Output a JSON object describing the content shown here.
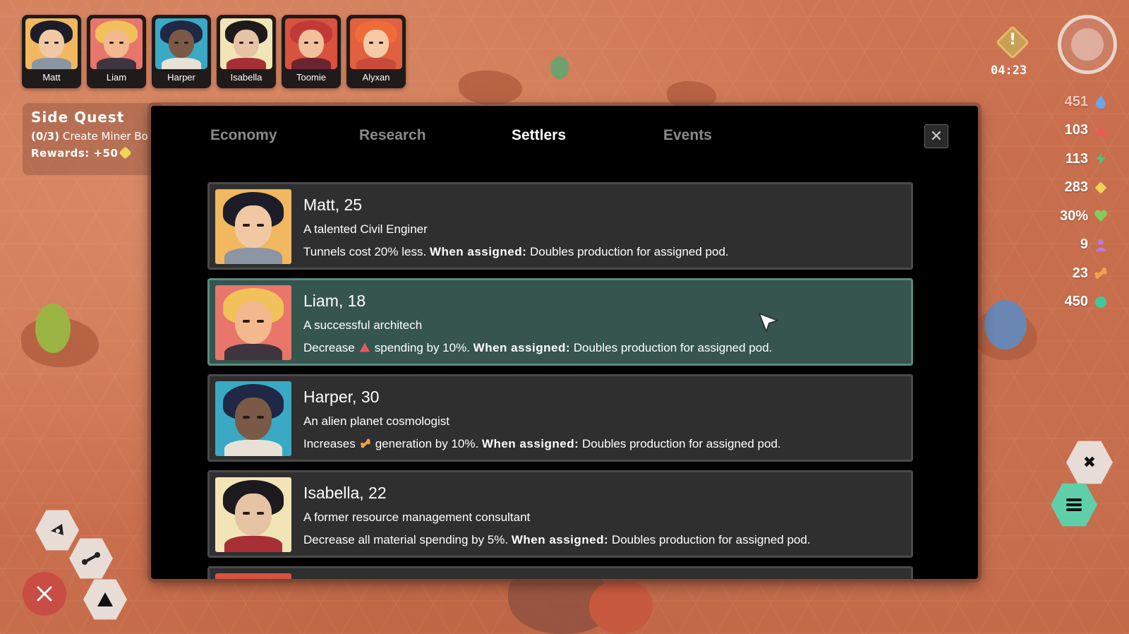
{
  "settlers_bar": [
    {
      "name": "Matt",
      "hair": "#1d1d2a",
      "skin": "#f0c9a4",
      "bg": "#f1b85f",
      "body": "#8b95a3"
    },
    {
      "name": "Liam",
      "hair": "#f1c25a",
      "skin": "#f3b88e",
      "bg": "#e8766a",
      "body": "#3f3540"
    },
    {
      "name": "Harper",
      "hair": "#202846",
      "skin": "#7a5a46",
      "bg": "#3aa9c4",
      "body": "#e8e2d6"
    },
    {
      "name": "Isabella",
      "hair": "#1c1a1c",
      "skin": "#e6c3a4",
      "bg": "#f1e4b6",
      "body": "#a82f36"
    },
    {
      "name": "Toomie",
      "hair": "#c23a35",
      "skin": "#f0c09a",
      "bg": "#d9523e",
      "body": "#6a2530"
    },
    {
      "name": "Alyxan",
      "hair": "#ef6b3a",
      "skin": "#f5caa6",
      "bg": "#e06040",
      "body": "#c84a3a"
    }
  ],
  "alert": {
    "mark": "!",
    "timer": "04:23"
  },
  "resources": [
    {
      "value": "451",
      "icon": "water-drop-icon",
      "color": "#6aa6e8",
      "faded": true
    },
    {
      "value": "103",
      "icon": "triangle-material-icon",
      "color": "#e85a5a",
      "faded": false
    },
    {
      "value": "113",
      "icon": "lightning-icon",
      "color": "#4fc27a",
      "faded": false
    },
    {
      "value": "283",
      "icon": "gold-coin-icon",
      "color": "#f2d35a",
      "faded": false
    },
    {
      "value": "30%",
      "icon": "heart-icon",
      "color": "#7fcf5a",
      "faded": false
    },
    {
      "value": "9",
      "icon": "settler-icon",
      "color": "#c07ad8",
      "faded": false
    },
    {
      "value": "23",
      "icon": "bone-food-icon",
      "color": "#f2a24a",
      "faded": false
    },
    {
      "value": "450",
      "icon": "teal-orb-icon",
      "color": "#3fc99a",
      "faded": false
    }
  ],
  "side_quest": {
    "title": "Side Quest",
    "progress": "(0/3)",
    "task": "Create Miner Bo",
    "rewards_label": "Rewards: +50"
  },
  "modal": {
    "tabs": [
      "Economy",
      "Research",
      "Settlers",
      "Events"
    ],
    "active_tab": "Settlers",
    "close_symbol": "✕",
    "settlers": [
      {
        "name": "Matt, 25",
        "role": "A talented Civil Enginer",
        "perk_prefix": "Tunnels cost 20% less. ",
        "perk_icon": "",
        "perk_suffix": "",
        "assigned_label": "When assigned:",
        "assigned_text": " Doubles production for assigned pod.",
        "selected": false
      },
      {
        "name": "Liam, 18",
        "role": "A successful architech",
        "perk_prefix": "Decrease",
        "perk_icon": "triangle-material-icon",
        "perk_suffix": "spending by 10%. ",
        "assigned_label": "When assigned:",
        "assigned_text": " Doubles production for assigned pod.",
        "selected": true
      },
      {
        "name": "Harper, 30",
        "role": "An alien planet cosmologist",
        "perk_prefix": "Increases",
        "perk_icon": "bone-food-icon",
        "perk_suffix": "generation by 10%. ",
        "assigned_label": "When assigned:",
        "assigned_text": " Doubles production for assigned pod.",
        "selected": false
      },
      {
        "name": "Isabella, 22",
        "role": "A former resource management consultant",
        "perk_prefix": "Decrease all material spending by 5%. ",
        "perk_icon": "",
        "perk_suffix": "",
        "assigned_label": "When assigned:",
        "assigned_text": " Doubles production for assigned pod.",
        "selected": false
      }
    ]
  },
  "controls": {
    "right_close_symbol": "✖",
    "menu_icon": "menu-icon",
    "left_icons": [
      "flag-icon",
      "connect-nodes-icon",
      "triangle-build-icon",
      "close-icon"
    ]
  }
}
